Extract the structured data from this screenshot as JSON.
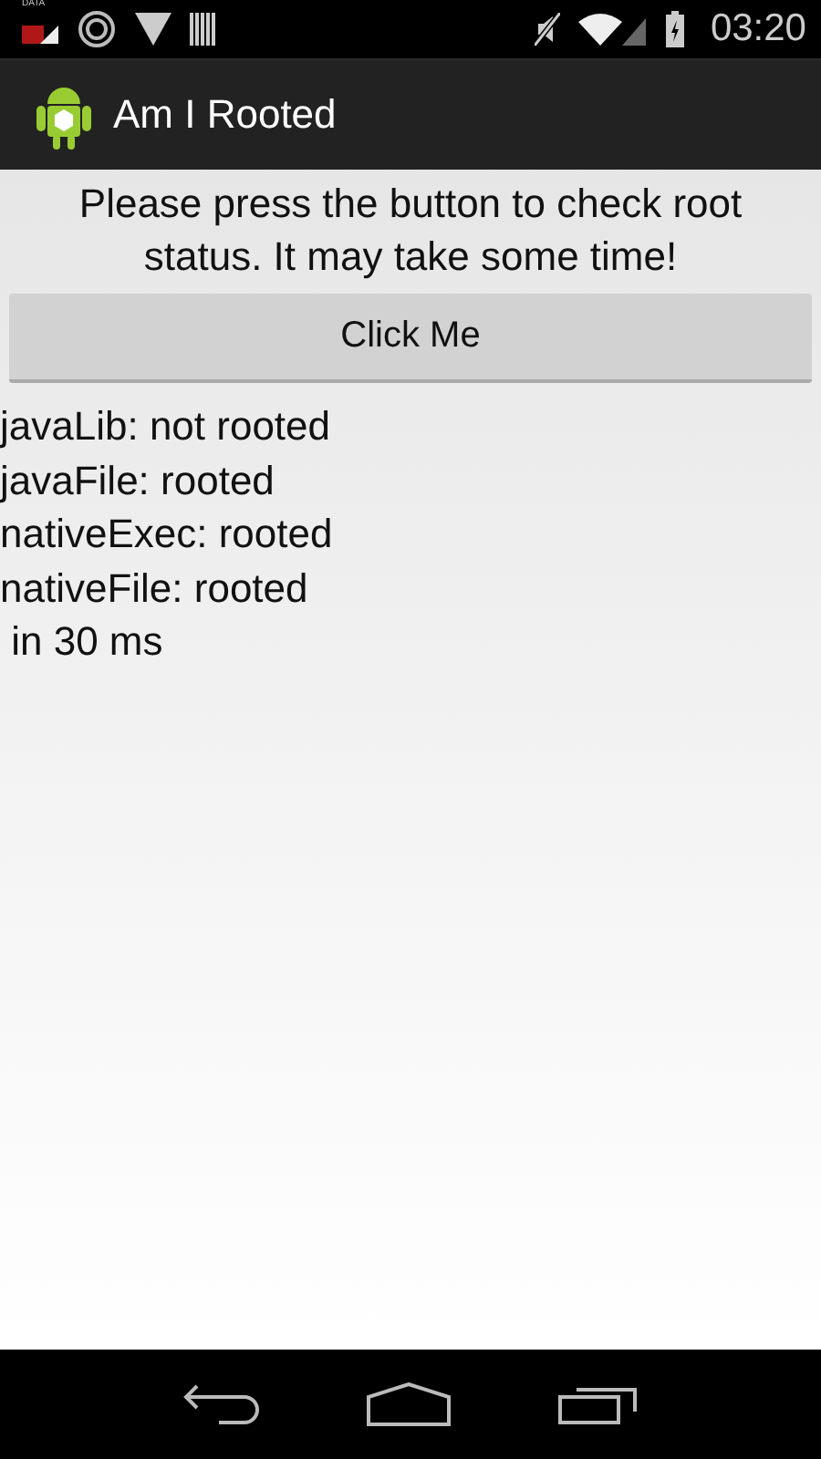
{
  "status_bar": {
    "data_label": "DATA",
    "time": "03:20"
  },
  "action_bar": {
    "title": "Am I Rooted"
  },
  "content": {
    "instructions": "Please press the button to check root status. It may take some time!",
    "button": "Click Me",
    "results": [
      "javaLib: not rooted",
      "javaFile: rooted",
      "nativeExec: rooted",
      "nativeFile: rooted",
      " in 30 ms"
    ]
  }
}
